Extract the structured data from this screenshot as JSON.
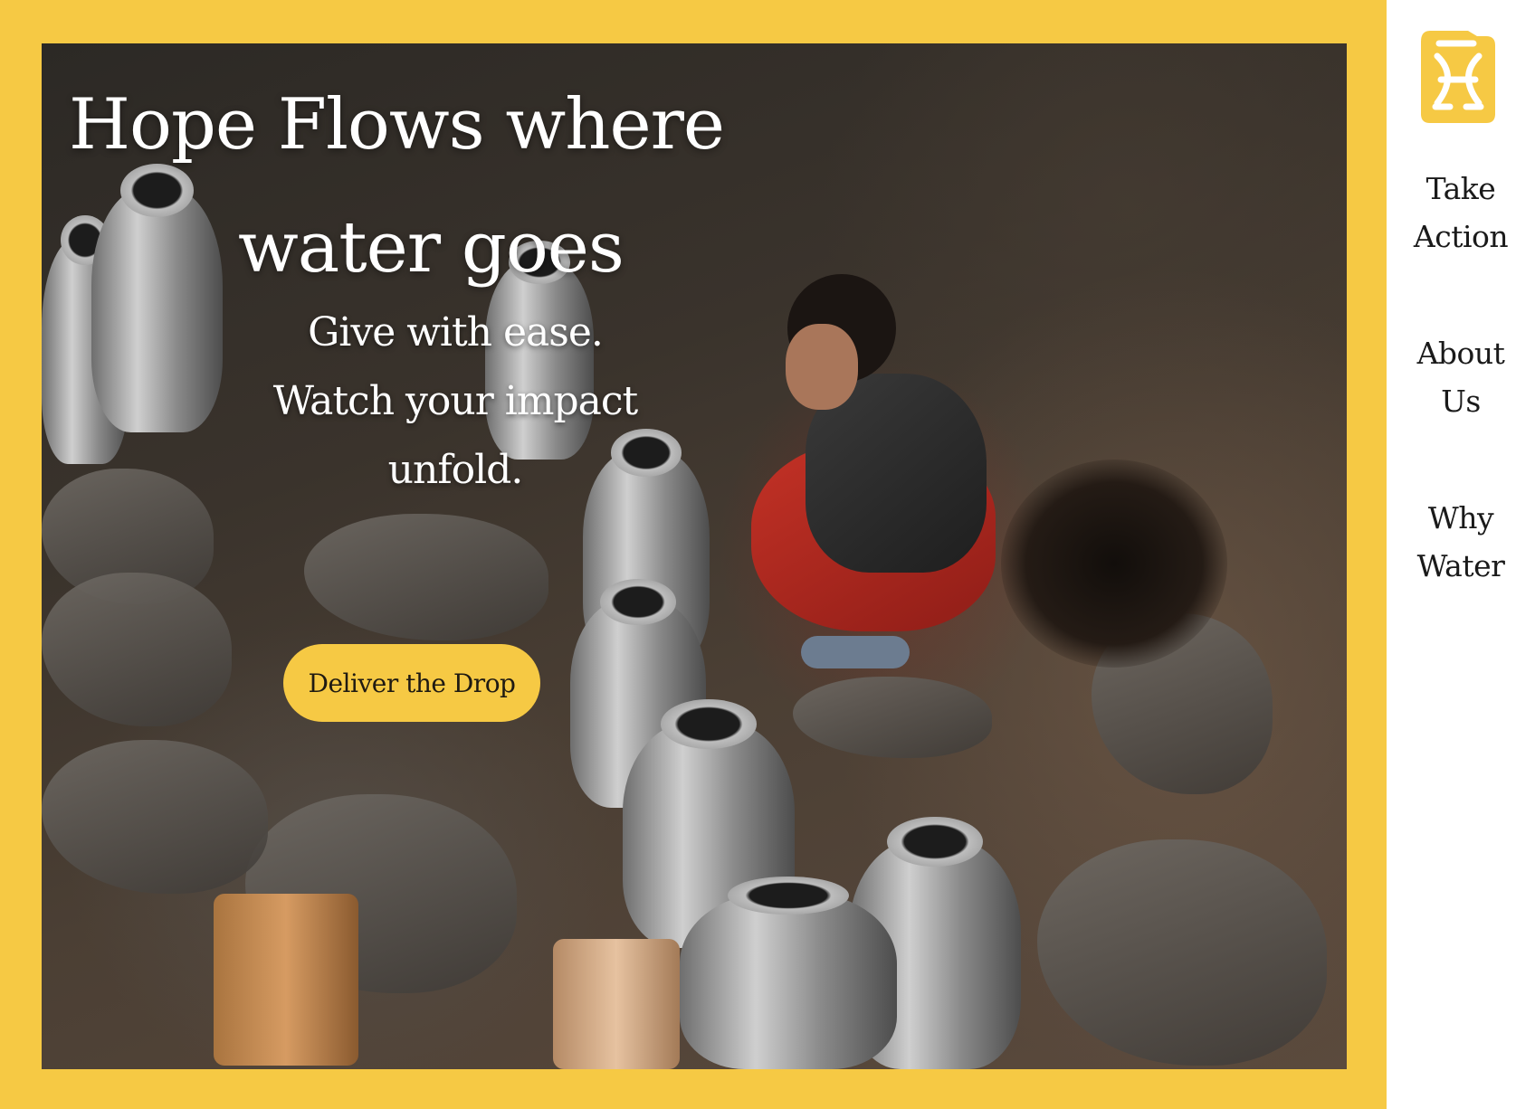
{
  "hero": {
    "title_line_1": "Hope Flows where",
    "title_line_2": "water goes",
    "subtitle_line_1": "Give with ease.",
    "subtitle_line_2": "Watch your impact",
    "subtitle_line_3": "unfold.",
    "cta_label": "Deliver the Drop"
  },
  "nav": {
    "logo_icon": "jerrycan-icon",
    "items": [
      {
        "line_1": "Take",
        "line_2": "Action"
      },
      {
        "line_1": "About",
        "line_2": "Us"
      },
      {
        "line_1": "Why",
        "line_2": "Water"
      }
    ]
  },
  "colors": {
    "accent": "#f6c944",
    "text_dark": "#1a1a1a",
    "text_light": "#ffffff",
    "background": "#ffffff"
  }
}
